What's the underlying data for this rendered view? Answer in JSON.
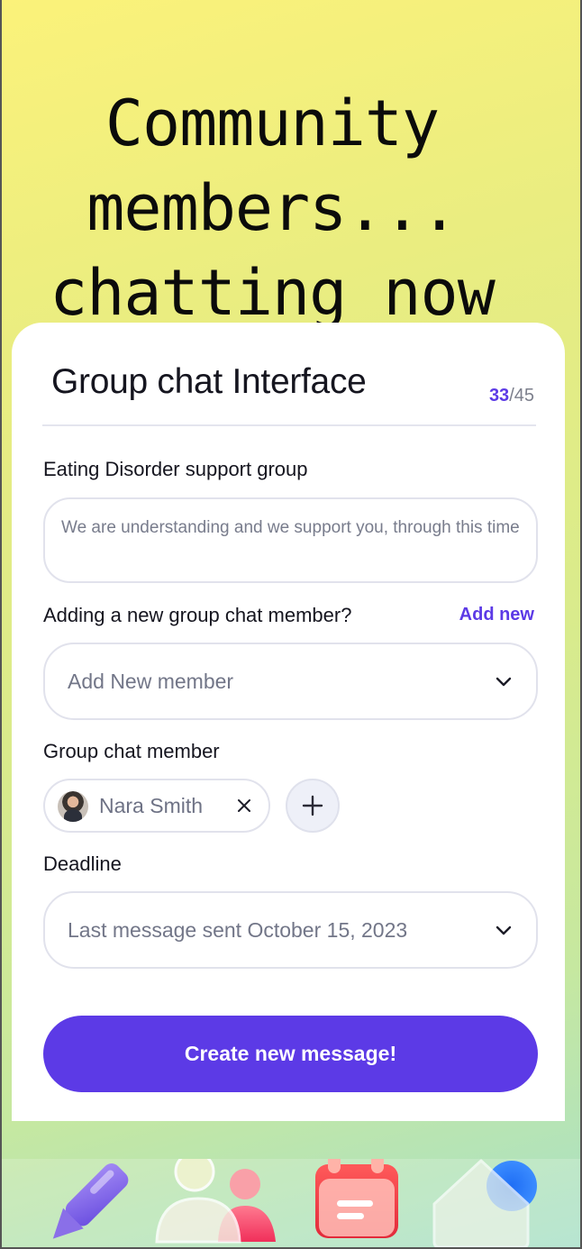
{
  "hero": {
    "lines": [
      "Community",
      "members...",
      "chatting now"
    ]
  },
  "card": {
    "title": "Group chat Interface",
    "counter_current": "33",
    "counter_total": "/45",
    "group_name_label": "Eating Disorder support group",
    "group_description": "We are understanding and we support you, through this time",
    "add_member_question": "Adding a new group chat member?",
    "add_new_link": "Add new",
    "add_member_select": "Add New member",
    "members_label": "Group chat member",
    "members": [
      {
        "name": "Nara Smith"
      }
    ],
    "deadline_label": "Deadline",
    "deadline_value": "Last message sent October 15, 2023",
    "submit_button": "Create new message!"
  },
  "tabbar": {
    "tabs": [
      {
        "icon": "pencil-icon"
      },
      {
        "icon": "people-icon"
      },
      {
        "icon": "calendar-icon"
      },
      {
        "icon": "home-icon"
      }
    ]
  },
  "colors": {
    "accent": "#5c3ae6",
    "text": "#15151f",
    "muted": "#787c8c",
    "border": "#e1e2ec"
  }
}
